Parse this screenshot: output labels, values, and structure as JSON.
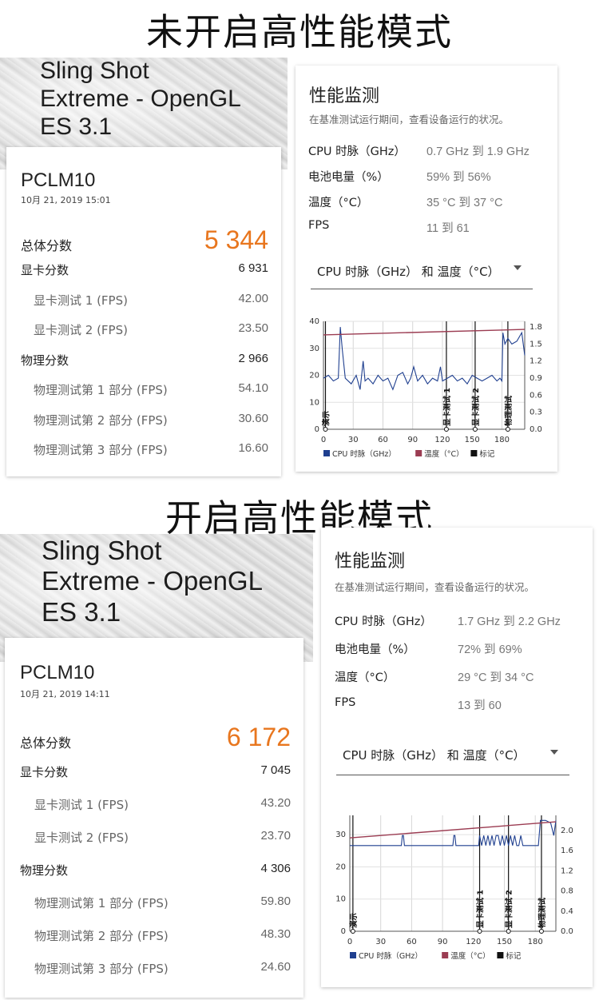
{
  "panels": [
    {
      "heading": "未开启高性能模式",
      "test_title_lines": [
        "Sling Shot",
        "Extreme - OpenGL",
        "ES 3.1"
      ],
      "device": "PCLM10",
      "date": "10月 21, 2019 15:01",
      "total_label": "总体分数",
      "total_score": "5 344",
      "rows": [
        {
          "label": "显卡分数",
          "value": "6 931",
          "sub": false
        },
        {
          "label": "显卡测试 1 (FPS)",
          "value": "42.00",
          "sub": true
        },
        {
          "label": "显卡测试 2 (FPS)",
          "value": "23.50",
          "sub": true
        },
        {
          "label": "物理分数",
          "value": "2 966",
          "sub": false
        },
        {
          "label": "物理测试第 1 部分 (FPS)",
          "value": "54.10",
          "sub": true
        },
        {
          "label": "物理测试第 2 部分 (FPS)",
          "value": "30.60",
          "sub": true
        },
        {
          "label": "物理测试第 3 部分 (FPS)",
          "value": "16.60",
          "sub": true
        }
      ],
      "monitor": {
        "title": "性能监测",
        "subtitle": "在基准测试运行期间，查看设备运行的状况。",
        "stats": [
          {
            "label": "CPU 时脉（GHz）",
            "value": "0.7 GHz 到 1.9 GHz"
          },
          {
            "label": "电池电量（%）",
            "value": "59% 到 56%"
          },
          {
            "label": "温度（°C）",
            "value": "35 °C 到 37 °C"
          },
          {
            "label": "FPS",
            "value": "11 到 61"
          }
        ],
        "dropdown": "CPU 时脉（GHz） 和 温度（°C）"
      }
    },
    {
      "heading": "开启高性能模式",
      "test_title_lines": [
        "Sling Shot",
        "Extreme - OpenGL",
        "ES 3.1"
      ],
      "device": "PCLM10",
      "date": "10月 21, 2019 14:11",
      "total_label": "总体分数",
      "total_score": "6 172",
      "rows": [
        {
          "label": "显卡分数",
          "value": "7 045",
          "sub": false
        },
        {
          "label": "显卡测试 1 (FPS)",
          "value": "43.20",
          "sub": true
        },
        {
          "label": "显卡测试 2 (FPS)",
          "value": "23.70",
          "sub": true
        },
        {
          "label": "物理分数",
          "value": "4 306",
          "sub": false
        },
        {
          "label": "物理测试第 1 部分 (FPS)",
          "value": "59.80",
          "sub": true
        },
        {
          "label": "物理测试第 2 部分 (FPS)",
          "value": "48.30",
          "sub": true
        },
        {
          "label": "物理测试第 3 部分 (FPS)",
          "value": "24.60",
          "sub": true
        }
      ],
      "monitor": {
        "title": "性能监测",
        "subtitle": "在基准测试运行期间，查看设备运行的状况。",
        "stats": [
          {
            "label": "CPU 时脉（GHz）",
            "value": "1.7 GHz 到 2.2 GHz"
          },
          {
            "label": "电池电量（%）",
            "value": "72% 到 69%"
          },
          {
            "label": "温度（°C）",
            "value": "29 °C 到 34 °C"
          },
          {
            "label": "FPS",
            "value": "13 到 60"
          }
        ],
        "dropdown": "CPU 时脉（GHz） 和 温度（°C）"
      }
    }
  ],
  "chart_data": [
    {
      "type": "line",
      "x_ticks": [
        0,
        30,
        60,
        90,
        120,
        150,
        180
      ],
      "y_left_ticks": [
        0,
        10,
        20,
        30,
        40
      ],
      "y_right_ticks": [
        "0.0",
        "0.3",
        "0.6",
        "0.9",
        "1.2",
        "1.5",
        "1.8"
      ],
      "xlim": [
        0,
        203
      ],
      "ylim_left": [
        0,
        40
      ],
      "ylim_right": [
        0,
        1.9
      ],
      "series": [
        {
          "name": "CPU 时脉（GHz）",
          "axis": "right",
          "color": "#1f3f8f",
          "x": [
            0,
            5,
            10,
            15,
            17,
            19,
            22,
            28,
            33,
            37,
            40,
            42,
            45,
            50,
            55,
            60,
            65,
            70,
            75,
            80,
            85,
            88,
            91,
            95,
            100,
            105,
            110,
            115,
            118,
            120,
            125,
            130,
            135,
            140,
            145,
            150,
            155,
            160,
            165,
            170,
            175,
            178,
            180,
            181,
            183,
            186,
            190,
            195,
            200,
            203
          ],
          "y": [
            0.9,
            0.95,
            0.85,
            0.9,
            1.8,
            1.4,
            0.9,
            0.8,
            0.95,
            0.7,
            1.2,
            0.85,
            0.9,
            0.8,
            0.95,
            0.85,
            0.9,
            0.7,
            0.95,
            1.0,
            0.8,
            0.9,
            1.1,
            0.85,
            0.95,
            0.8,
            0.9,
            0.85,
            1.1,
            0.85,
            0.9,
            0.95,
            0.85,
            0.9,
            0.8,
            0.95,
            0.9,
            0.85,
            0.9,
            0.95,
            0.85,
            0.9,
            0.85,
            1.7,
            1.5,
            1.6,
            1.5,
            1.55,
            1.7,
            1.3
          ]
        },
        {
          "name": "温度（°C）",
          "axis": "left",
          "color": "#9b3c52",
          "x": [
            0,
            203
          ],
          "y": [
            35,
            37
          ]
        }
      ],
      "markers": [
        {
          "label": "演示",
          "x": 2
        },
        {
          "label": "显卡测试 1",
          "x": 124
        },
        {
          "label": "显卡测试 2",
          "x": 153
        },
        {
          "label": "物理测试",
          "x": 186
        }
      ],
      "legend": [
        {
          "label": "CPU 时脉（GHz）",
          "color": "#1f3f8f"
        },
        {
          "label": "温度（°C）",
          "color": "#9b3c52"
        },
        {
          "label": "标记",
          "color": "#111111"
        }
      ]
    },
    {
      "type": "line",
      "x_ticks": [
        0,
        30,
        60,
        90,
        120,
        150,
        180
      ],
      "y_left_ticks": [
        0,
        10,
        20,
        30
      ],
      "y_right_ticks": [
        "0.0",
        "0.4",
        "0.8",
        "1.2",
        "1.6",
        "2.0"
      ],
      "xlim": [
        0,
        200
      ],
      "ylim_left": [
        0,
        36
      ],
      "ylim_right": [
        0,
        2.3
      ],
      "series": [
        {
          "name": "CPU 时脉（GHz）",
          "axis": "right",
          "color": "#1f3f8f",
          "x": [
            0,
            50,
            51,
            52,
            53,
            100,
            101,
            102,
            103,
            125,
            126,
            128,
            130,
            132,
            134,
            136,
            138,
            140,
            142,
            144,
            146,
            148,
            150,
            152,
            154,
            156,
            158,
            160,
            162,
            164,
            166,
            168,
            170,
            183,
            185,
            190,
            195,
            198,
            200
          ],
          "y": [
            1.7,
            1.7,
            1.9,
            1.9,
            1.7,
            1.7,
            1.9,
            1.9,
            1.7,
            1.7,
            1.9,
            1.7,
            1.9,
            1.7,
            1.9,
            1.7,
            1.9,
            1.7,
            1.9,
            1.9,
            1.7,
            1.9,
            1.7,
            1.9,
            1.7,
            1.9,
            1.7,
            1.9,
            1.7,
            1.7,
            1.9,
            1.7,
            1.7,
            1.7,
            2.2,
            2.2,
            2.15,
            1.9,
            2.2
          ]
        },
        {
          "name": "温度（°C）",
          "axis": "left",
          "color": "#9b3c52",
          "x": [
            0,
            200
          ],
          "y": [
            29,
            34
          ]
        }
      ],
      "markers": [
        {
          "label": "演示",
          "x": 3
        },
        {
          "label": "显卡测试 1",
          "x": 126
        },
        {
          "label": "显卡测试 2",
          "x": 154
        },
        {
          "label": "物理测试",
          "x": 186
        }
      ],
      "legend": [
        {
          "label": "CPU 时脉（GHz）",
          "color": "#1f3f8f"
        },
        {
          "label": "温度（°C）",
          "color": "#9b3c52"
        },
        {
          "label": "标记",
          "color": "#111111"
        }
      ]
    }
  ]
}
